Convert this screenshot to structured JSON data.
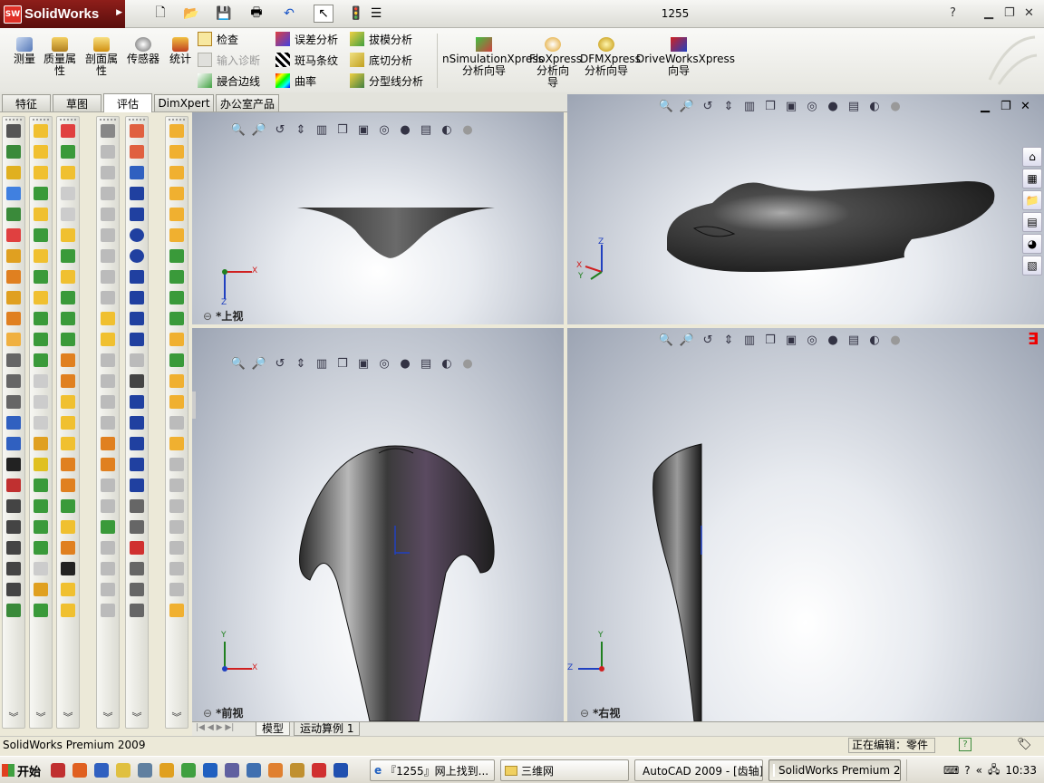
{
  "app": {
    "brand": "SolidWorks",
    "document_title": "1255"
  },
  "ribbon": {
    "big_buttons": [
      {
        "label": "测量",
        "icon": "measure-icon"
      },
      {
        "label": "质量属性",
        "icon": "mass-properties-icon"
      },
      {
        "label": "剖面属性",
        "icon": "section-properties-icon"
      },
      {
        "label": "传感器",
        "icon": "sensor-icon"
      },
      {
        "label": "统计",
        "icon": "statistics-icon"
      }
    ],
    "col1": [
      {
        "label": "检查",
        "icon": "check-icon",
        "enabled": true
      },
      {
        "label": "输入诊断",
        "icon": "import-diagnostics-icon",
        "enabled": false
      },
      {
        "label": "誛合边线",
        "icon": "weld-edge-icon",
        "enabled": true
      }
    ],
    "col2": [
      {
        "label": "误差分析",
        "icon": "deviation-analysis-icon"
      },
      {
        "label": "斑马条纹",
        "icon": "zebra-stripes-icon"
      },
      {
        "label": "曲率",
        "icon": "curvature-icon"
      }
    ],
    "col3": [
      {
        "label": "拔模分析",
        "icon": "draft-analysis-icon"
      },
      {
        "label": "底切分析",
        "icon": "undercut-analysis-icon"
      },
      {
        "label": "分型线分析",
        "icon": "parting-line-analysis-icon"
      }
    ],
    "xpress": [
      {
        "line1": "nSimulationXpress",
        "line2": "分析向导",
        "line3": "",
        "icon": "simulationxpress-icon"
      },
      {
        "line1": "FloXpress",
        "line2": "分析向",
        "line3": "导",
        "icon": "floxpress-icon"
      },
      {
        "line1": "DFMXpress",
        "line2": "分析向导",
        "line3": "",
        "icon": "dfmxpress-icon"
      },
      {
        "line1": "DriveWorksXpress",
        "line2": "向导",
        "line3": "",
        "icon": "driveworksxpress-icon"
      }
    ]
  },
  "tabs": [
    {
      "label": "特征"
    },
    {
      "label": "草图"
    },
    {
      "label": "评估",
      "active": true
    },
    {
      "label": "DimXpert"
    },
    {
      "label": "办公室产品"
    }
  ],
  "viewports": {
    "top": {
      "label": "*上视",
      "axis1": "X",
      "axis2": "Z"
    },
    "trimetric": {
      "axis1": "Z",
      "axis2": "X",
      "axis3": "Y"
    },
    "front": {
      "label": "*前视",
      "axis1": "Y",
      "axis2": "X"
    },
    "right": {
      "label": "*右视",
      "axis1": "Y",
      "axis2": "Z"
    }
  },
  "model_tabs": [
    {
      "label": "模型"
    },
    {
      "label": "运动算例 1"
    }
  ],
  "status": {
    "left": "SolidWorks Premium 2009",
    "editing": "正在编辑：零件",
    "help": "?"
  },
  "taskbar": {
    "start": "开始",
    "tasks": [
      {
        "label": "『1255』网上找到...",
        "icon": "ie-icon"
      },
      {
        "label": "三维网",
        "icon": "folder-icon"
      },
      {
        "label": "AutoCAD 2009 - [齿轴]",
        "icon": "autocad-icon"
      },
      {
        "label": "SolidWorks Premium 2...",
        "icon": "solidworks-icon",
        "active": true
      }
    ],
    "clock": "10:33"
  }
}
